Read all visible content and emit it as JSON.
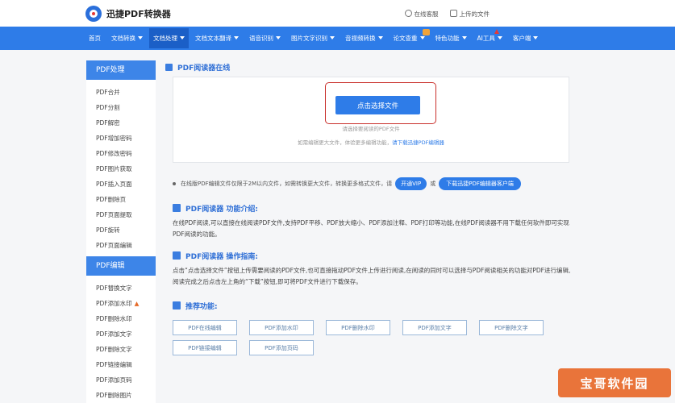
{
  "header": {
    "logo_text": "迅捷PDF转换器",
    "links": [
      "在线客服",
      "上传的文件"
    ]
  },
  "nav": {
    "items": [
      {
        "label": "首页",
        "caret": false
      },
      {
        "label": "文档转换",
        "caret": true
      },
      {
        "label": "文档处理",
        "caret": true,
        "active": true
      },
      {
        "label": "文档文本翻译",
        "caret": true
      },
      {
        "label": "语音识别",
        "caret": true
      },
      {
        "label": "图片文字识别",
        "caret": true
      },
      {
        "label": "音视频转换",
        "caret": true
      },
      {
        "label": "论文查重",
        "caret": true,
        "badge": "new"
      },
      {
        "label": "特色功能",
        "caret": true
      },
      {
        "label": "AI工具",
        "caret": true,
        "badge": "hot"
      },
      {
        "label": "客户端",
        "caret": true
      }
    ]
  },
  "sidebar": {
    "section1_title": "PDF处理",
    "section1_items": [
      "PDF合并",
      "PDF分割",
      "PDF解密",
      "PDF增加密码",
      "PDF修改密码",
      "PDF图片获取",
      "PDF插入页面",
      "PDF删除页",
      "PDF页面提取",
      "PDF旋转",
      "PDF页面编辑"
    ],
    "section2_title": "PDF编辑",
    "section2_items": [
      "PDF替换文字",
      "PDF添加水印",
      "PDF删除水印",
      "PDF添加文字",
      "PDF删除文字",
      "PDF链接编辑",
      "PDF添加页码",
      "PDF删除图片"
    ]
  },
  "main": {
    "title": "PDF阅读器在线",
    "upload_button": "点击选择文件",
    "upload_hint1": "请选择要阅读的PDF文件",
    "upload_hint2_prefix": "如需编辑更大文件，体验更多编辑功能，",
    "upload_hint2_link": "请下载迅捷PDF编辑器",
    "notice_text": "在线版PDF编辑文件仅限于2M以内文件，如需转换更大文件，转换更多格式文件，请",
    "notice_btn1": "开通VIP",
    "notice_or": "或",
    "notice_btn2": "下载迅捷PDF编辑器客户端",
    "intro_title": "PDF阅读器 功能介绍:",
    "intro_text": "在线PDF阅读,可以直接在线阅读PDF文件,支持PDF平移、PDF放大缩小、PDF添加注释、PDF打印等功能,在线PDF阅读器不用下载任何软件即可实现PDF阅读的功能。",
    "guide_title": "PDF阅读器 操作指南:",
    "guide_text": "点击“点击选择文件”按钮上传需要阅读的PDF文件,也可直接拖动PDF文件上传进行阅读,在阅读的同时可以选择与PDF阅读相关的功能对PDF进行编辑,阅读完成之后点击左上角的“下载”按钮,即可将PDF文件进行下载保存。",
    "recommend_title": "推荐功能:",
    "recommend_row1": [
      "PDF在线编辑",
      "PDF添加水印",
      "PDF删除水印",
      "PDF添加文字",
      "PDF删除文字"
    ],
    "recommend_row2": [
      "PDF链接编辑",
      "PDF添加页码"
    ]
  },
  "watermark": "宝哥软件园"
}
